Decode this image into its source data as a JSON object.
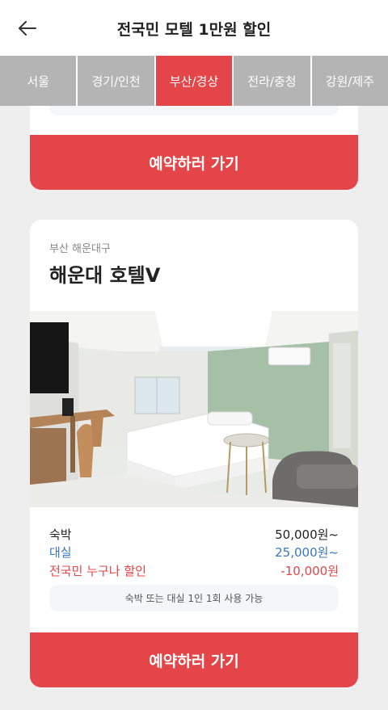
{
  "header": {
    "title": "전국민 모텔 1만원 할인"
  },
  "tabs": [
    {
      "label": "서울",
      "active": false
    },
    {
      "label": "경기/인천",
      "active": false
    },
    {
      "label": "부산/경상",
      "active": true
    },
    {
      "label": "전라/충청",
      "active": false
    },
    {
      "label": "강원/제주",
      "active": false
    }
  ],
  "prev_card": {
    "button_label": "예약하러 가기"
  },
  "hotel": {
    "location": "부산 해운대구",
    "name": "해운대 호텔V",
    "prices": [
      {
        "label": "숙박",
        "value": "50,000원~"
      },
      {
        "label": "대실",
        "value": "25,000원~"
      },
      {
        "label": "전국민 누구나 할인",
        "value": "-10,000원"
      }
    ],
    "notice": "숙박 또는 대실 1인 1회 사용 가능",
    "button_label": "예약하러 가기"
  },
  "colors": {
    "accent": "#e34548",
    "tab_inactive": "#b4b4b4",
    "blue": "#3a76c3",
    "background": "#eeeeee"
  }
}
